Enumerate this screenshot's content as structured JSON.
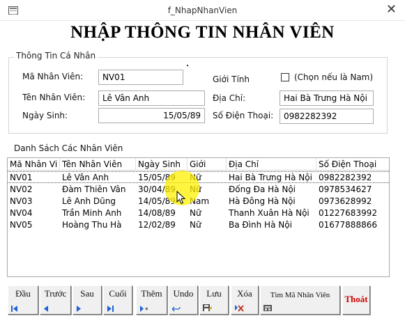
{
  "window": {
    "title": "f_NhapNhanVien",
    "close": "✕"
  },
  "form": {
    "heading": "NHẬP THÔNG TIN NHÂN VIÊN"
  },
  "personal": {
    "legend": "Thông Tin Cá Nhân",
    "employee_id_label": "Mã Nhân Viên:",
    "employee_id_value": "NV01",
    "name_label": "Tên Nhân Viên:",
    "name_value": "Lê Vân Anh",
    "birthdate_label": "Ngày Sinh:",
    "birthdate_value": "15/05/89",
    "gender_label": "Giới Tính",
    "gender_hint": "(Chọn nếu là Nam)",
    "gender_checked": false,
    "address_label": "Địa Chỉ:",
    "address_value": "Hai Bà Trưng Hà Nội",
    "phone_label": "Số Điện Thoại:",
    "phone_value": "0982282392"
  },
  "list": {
    "title": "Danh Sách Các Nhân Viên",
    "columns": [
      "Mã Nhân Vi",
      "Tên Nhân Viên",
      "Ngày Sinh",
      "Giới",
      "Địa Chỉ",
      "Số Điện Thoại"
    ],
    "rows": [
      [
        "NV01",
        "Lê Vân Anh",
        "15/05/89",
        "Nữ",
        "Hai Bà Trưng Hà Nội",
        "0982282392"
      ],
      [
        "NV02",
        "Đàm Thiên Vân",
        "30/04/89",
        "Nữ",
        "Đống Đa Hà Nội",
        "0978534627"
      ],
      [
        "NV03",
        "Lê Anh Dũng",
        "14/05/89",
        "Nam",
        "Hà Đông Hà Nội",
        "0973628992"
      ],
      [
        "NV04",
        "Trần Minh Anh",
        "14/08/89",
        "Nữ",
        "Thanh Xuân Hà Nội",
        "01227683992"
      ],
      [
        "NV05",
        "Hoàng Thu Hà",
        "12/02/89",
        "Nữ",
        "Ba Đình Hà Nội",
        "01677888866"
      ]
    ],
    "selected_index": 0
  },
  "toolbar": {
    "first": "Đầu",
    "prev": "Trước",
    "next": "Sau",
    "last": "Cuối",
    "add": "Thêm",
    "undo": "Undo",
    "save": "Lưu",
    "delete": "Xóa",
    "find": "Tìm Mã Nhân Viên",
    "exit": "Thoát"
  },
  "colors": {
    "nav_icon": "#1f5fd6",
    "delete_icon": "#c0392b",
    "exit_text": "#cc0000",
    "highlight": "#fff000"
  }
}
